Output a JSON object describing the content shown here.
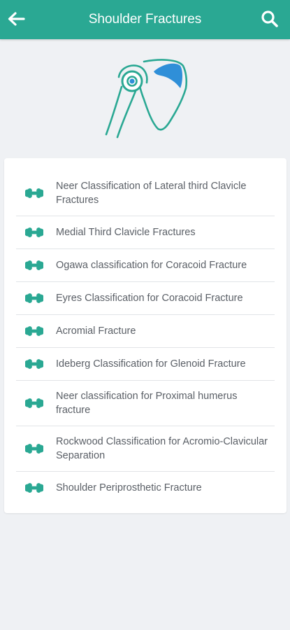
{
  "header": {
    "title": "Shoulder Fractures",
    "back_icon": "arrow-left-icon",
    "search_icon": "search-icon"
  },
  "hero": {
    "icon": "shoulder-joint-icon"
  },
  "list": {
    "item_icon": "bone-icon",
    "items": [
      {
        "label": "Neer Classification of Lateral third Clavicle Fractures"
      },
      {
        "label": "Medial Third Clavicle Fractures"
      },
      {
        "label": "Ogawa classification for Coracoid Fracture"
      },
      {
        "label": "Eyres Classification for Coracoid Fracture"
      },
      {
        "label": "Acromial Fracture"
      },
      {
        "label": "Ideberg Classification for Glenoid Fracture"
      },
      {
        "label": "Neer classification for Proximal humerus fracture"
      },
      {
        "label": "Rockwood Classification for Acromio-Clavicular Separation"
      },
      {
        "label": "Shoulder Periprosthetic Fracture"
      }
    ]
  },
  "colors": {
    "primary": "#2aa893",
    "accent_blue": "#2f8fd8",
    "background": "#eff1f4",
    "text": "#5a5f66"
  }
}
